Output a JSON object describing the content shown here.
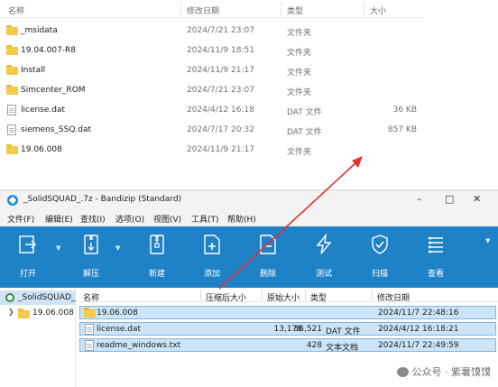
{
  "explorer": {
    "columns": {
      "name": "名称",
      "date": "修改日期",
      "type": "类型",
      "size": "大小"
    },
    "rows": [
      {
        "name": "_msidata",
        "date": "2024/7/21 23:07",
        "type": "文件夹",
        "size": "",
        "icon": "folder-icon"
      },
      {
        "name": "19.04.007-R8",
        "date": "2024/11/9 18:51",
        "type": "文件夹",
        "size": "",
        "icon": "folder-icon"
      },
      {
        "name": "Install",
        "date": "2024/11/9 21:17",
        "type": "文件夹",
        "size": "",
        "icon": "folder-icon"
      },
      {
        "name": "Simcenter_ROM",
        "date": "2024/7/21 23:07",
        "type": "文件夹",
        "size": "",
        "icon": "folder-icon"
      },
      {
        "name": "license.dat",
        "date": "2024/4/12 16:18",
        "type": "DAT 文件",
        "size": "36 KB",
        "icon": "file-icon"
      },
      {
        "name": "siemens_SSQ.dat",
        "date": "2024/7/17 20:32",
        "type": "DAT 文件",
        "size": "857 KB",
        "icon": "file-icon"
      },
      {
        "name": "19.06.008",
        "date": "2024/11/9 21:17",
        "type": "文件夹",
        "size": "",
        "icon": "folder-icon"
      }
    ]
  },
  "bandizip": {
    "title": "_SolidSQUAD_.7z - Bandizip (Standard)",
    "menu": [
      "文件(F)",
      "编辑(E)",
      "查找(I)",
      "选项(O)",
      "视图(V)",
      "工具(T)",
      "帮助(H)"
    ],
    "toolbar": [
      {
        "label": "打开",
        "icon": "open-icon"
      },
      {
        "label": "解压",
        "icon": "extract-icon"
      },
      {
        "label": "新建",
        "icon": "new-archive-icon"
      },
      {
        "label": "添加",
        "icon": "add-icon"
      },
      {
        "label": "删除",
        "icon": "delete-icon"
      },
      {
        "label": "测试",
        "icon": "test-icon"
      },
      {
        "label": "扫描",
        "icon": "scan-icon"
      },
      {
        "label": "查看",
        "icon": "view-icon"
      }
    ],
    "tree": {
      "root": "_SolidSQUAD_",
      "child": "19.06.008"
    },
    "list_columns": {
      "name": "名称",
      "compressed": "压缩后大小",
      "original": "原始大小",
      "type": "类型",
      "modified": "修改日期"
    },
    "list_rows": [
      {
        "name": "19.06.008",
        "compressed": "",
        "original": "",
        "type": "",
        "modified": "2024/11/7 22:48:16",
        "icon": "folder-icon"
      },
      {
        "name": "license.dat",
        "compressed": "13,178",
        "original": "36,521",
        "type": "DAT 文件",
        "modified": "2024/4/12 16:18:21",
        "icon": "file-icon"
      },
      {
        "name": "readme_windows.txt",
        "compressed": "",
        "original": "428",
        "type": "文本文档",
        "modified": "2024/11/7 22:49:59",
        "icon": "file-icon"
      }
    ]
  },
  "watermark": "公众号 · 紫薯馍馍",
  "colors": {
    "toolbar": "#1f82c6",
    "selection": "#cde4f7",
    "arrow": "#e03030",
    "folder": "#f6c94a"
  }
}
